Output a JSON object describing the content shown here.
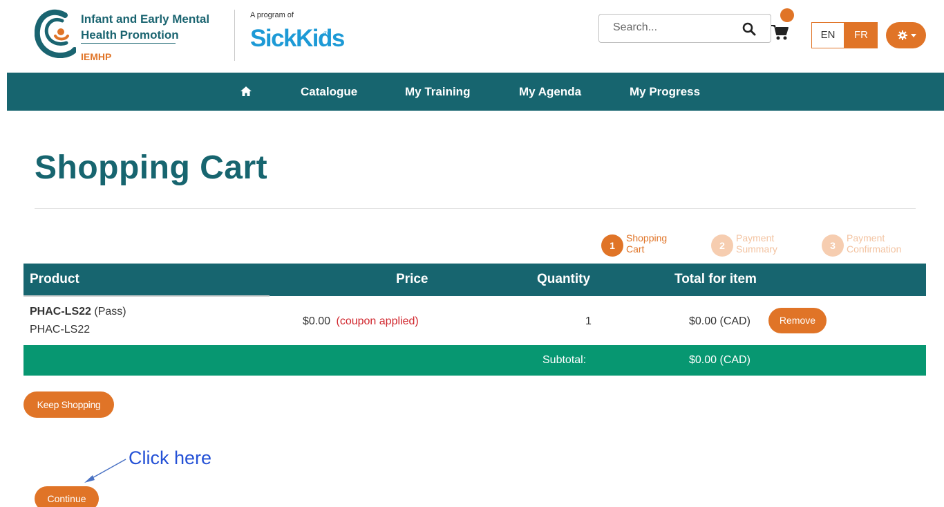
{
  "header": {
    "logo_text_line1": "Infant and Early Mental",
    "logo_text_line2": "Health Promotion",
    "logo_abbr": "IEMHP",
    "program_of": "A program of",
    "partner_logo": "SickKids",
    "partner_logo_mark": "®",
    "search": {
      "placeholder": "Search..."
    },
    "lang": {
      "en": "EN",
      "fr": "FR"
    }
  },
  "nav": {
    "items": [
      {
        "label": "Catalogue"
      },
      {
        "label": "My Training"
      },
      {
        "label": "My Agenda"
      },
      {
        "label": "My Progress"
      }
    ]
  },
  "main": {
    "title": "Shopping Cart",
    "steps": [
      {
        "num": "1",
        "line1": "Shopping",
        "line2": "Cart",
        "state": "active"
      },
      {
        "num": "2",
        "line1": "Payment",
        "line2": "Summary",
        "state": "inactive"
      },
      {
        "num": "3",
        "line1": "Payment",
        "line2": "Confirmation",
        "state": "inactive"
      }
    ],
    "table": {
      "headers": {
        "product": "Product",
        "price": "Price",
        "quantity": "Quantity",
        "total": "Total for item"
      },
      "rows": [
        {
          "product_code": "PHAC-LS22",
          "product_type": "(Pass)",
          "product_sub": "PHAC-LS22",
          "price": "$0.00",
          "coupon": "(coupon applied)",
          "quantity": "1",
          "total": "$0.00 (CAD)",
          "remove_label": "Remove"
        }
      ],
      "subtotal_label": "Subtotal:",
      "subtotal_value": "$0.00 (CAD)"
    },
    "keep_shopping_label": "Keep Shopping",
    "annotation": "Click here",
    "continue_label": "Continue"
  },
  "colors": {
    "teal": "#17656f",
    "orange": "#e07427",
    "green": "#079771",
    "coupon_red": "#d0242b",
    "annotation_blue": "#2451d6"
  },
  "icons": [
    "iemhp-logo-icon",
    "search-icon",
    "cart-icon",
    "gear-icon",
    "home-icon",
    "arrow-icon"
  ]
}
